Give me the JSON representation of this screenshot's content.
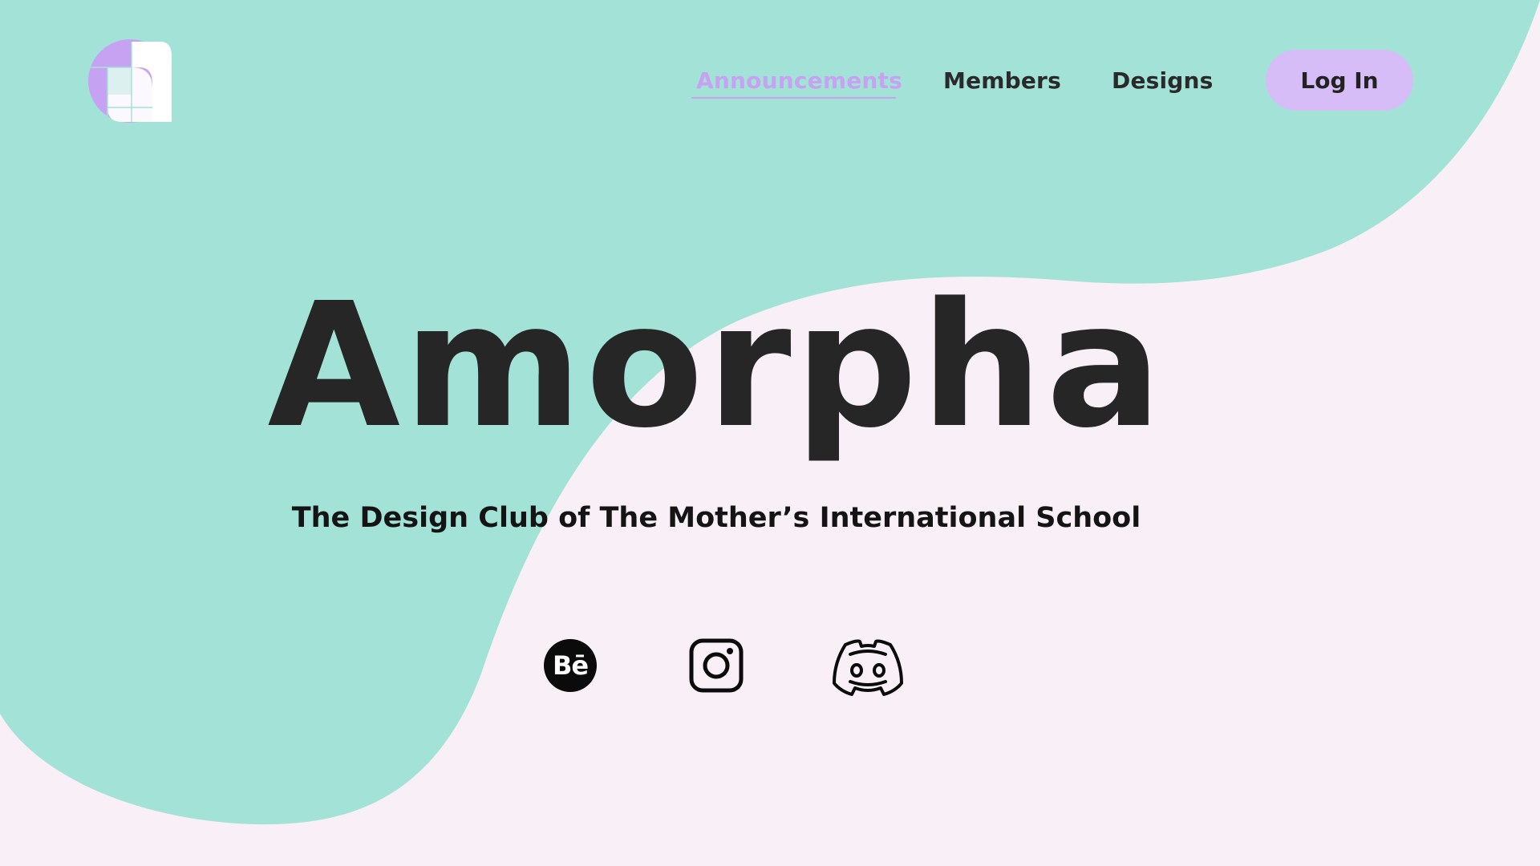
{
  "app": {
    "logo_name": "amorpha-logo",
    "colors": {
      "background": "#f9eff6",
      "blob": "#a3e2d6",
      "accent": "#c8a2f2",
      "button": "#d6bdf7",
      "text": "#262626"
    }
  },
  "nav": {
    "items": [
      {
        "label": "Announcements",
        "active": true
      },
      {
        "label": "Members",
        "active": false
      },
      {
        "label": "Designs",
        "active": false
      }
    ],
    "login_label": "Log In"
  },
  "hero": {
    "title": "Amorpha",
    "subtitle": "The Design Club of The Mother’s International School"
  },
  "social": {
    "behance": {
      "icon": "behance-icon",
      "glyph": "Bē"
    },
    "instagram": {
      "icon": "instagram-icon"
    },
    "discord": {
      "icon": "discord-icon"
    }
  }
}
